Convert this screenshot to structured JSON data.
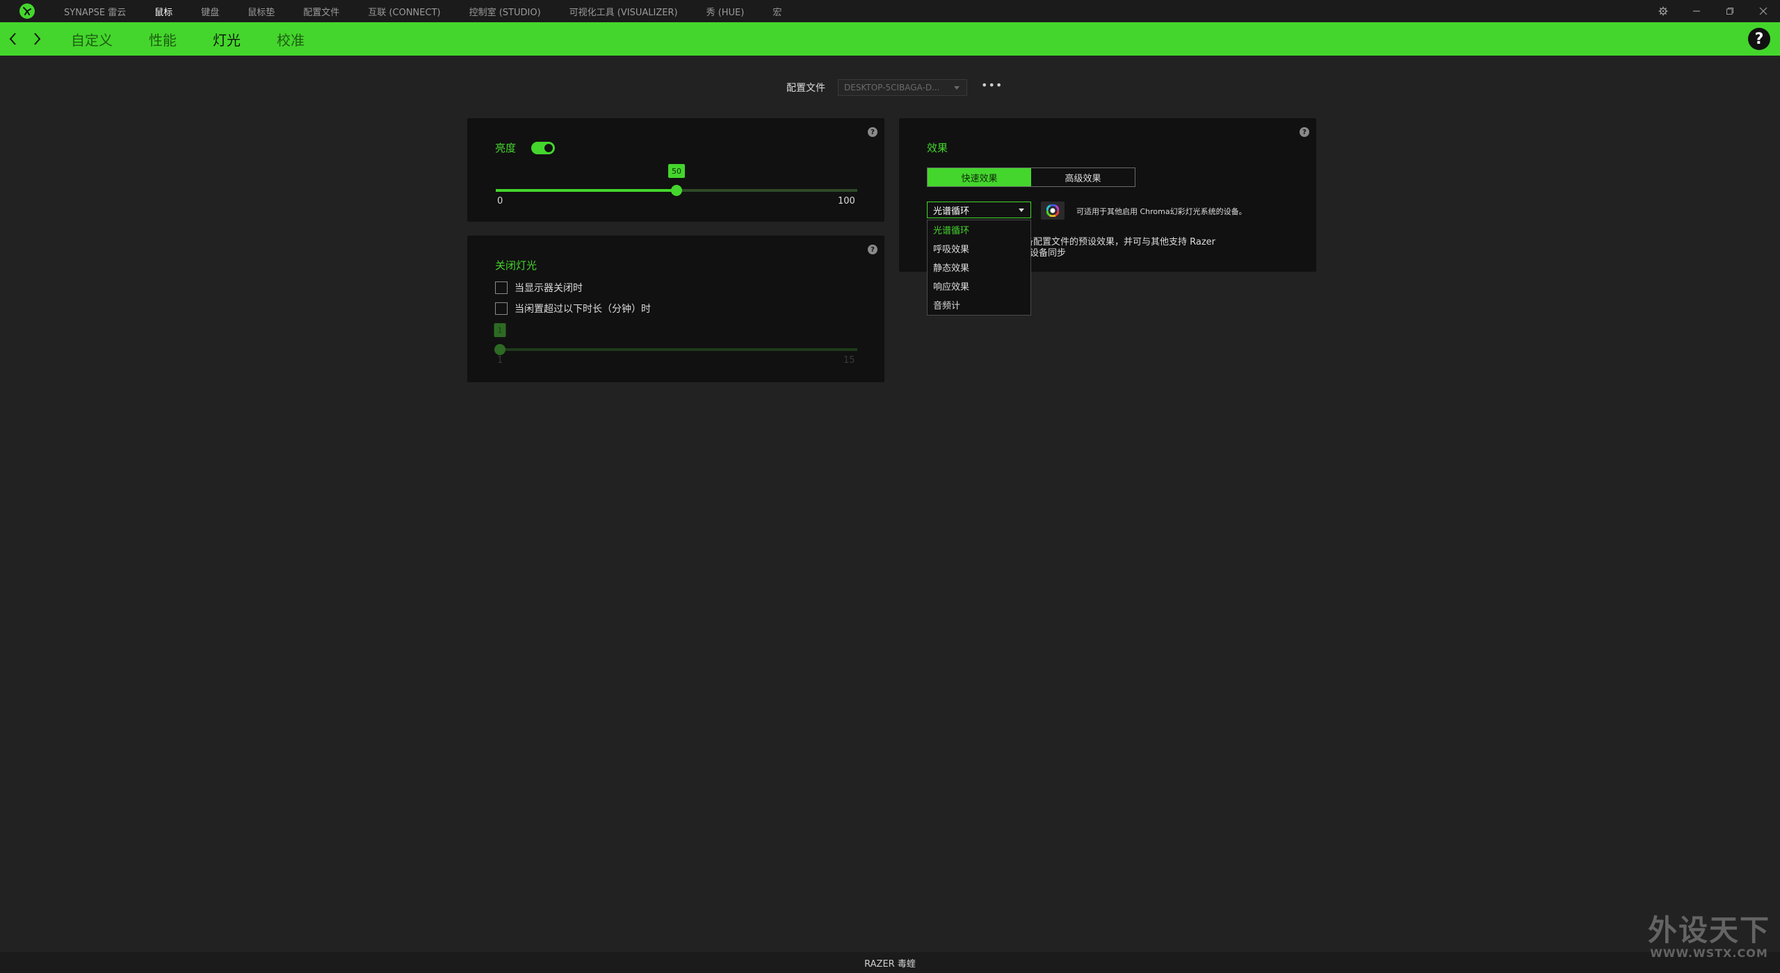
{
  "topnav": {
    "items": [
      "SYNAPSE 雷云",
      "鼠标",
      "键盘",
      "鼠标垫",
      "配置文件",
      "互联 (CONNECT)",
      "控制室 (STUDIO)",
      "可视化工具 (VISUALIZER)",
      "秀 (HUE)",
      "宏"
    ],
    "active_index": 1
  },
  "subnav": {
    "tabs": [
      "自定义",
      "性能",
      "灯光",
      "校准"
    ],
    "active_index": 2,
    "help": "?"
  },
  "profile": {
    "label": "配置文件",
    "value": "DESKTOP-5CIBAGA-D...",
    "more": "•••"
  },
  "brightness": {
    "title": "亮度",
    "enabled": true,
    "value": 50,
    "value_label": "50",
    "min_label": "0",
    "max_label": "100",
    "min": 0,
    "max": 100
  },
  "lights_off": {
    "title": "关闭灯光",
    "options": [
      {
        "label": "当显示器关闭时",
        "checked": false
      },
      {
        "label": "当闲置超过以下时长（分钟）时",
        "checked": false
      }
    ],
    "slider": {
      "value": 1,
      "value_label": "1",
      "min": 1,
      "max": 15,
      "min_label": "1",
      "max_label": "15",
      "enabled": false
    }
  },
  "effects": {
    "title": "效果",
    "segments": [
      "快速效果",
      "高级效果"
    ],
    "active_segment": 0,
    "selected": "光谱循环",
    "chroma_note": "可适用于其他启用 Chroma幻彩灯光系统的设备。",
    "desc_line1": "备配置文件的预设效果，并可与其他支持 Razer",
    "desc_line2": "设备同步",
    "dropdown_items": [
      "光谱循环",
      "呼吸效果",
      "静态效果",
      "响应效果",
      "音频计"
    ],
    "dropdown_selected_index": 0
  },
  "footer": {
    "device": "RAZER 毒蝰"
  },
  "watermark": {
    "line1": "外设天下",
    "line2": "WWW.WSTX.COM"
  },
  "colors": {
    "accent": "#44d62c",
    "background": "#222222",
    "panel": "#111111"
  }
}
